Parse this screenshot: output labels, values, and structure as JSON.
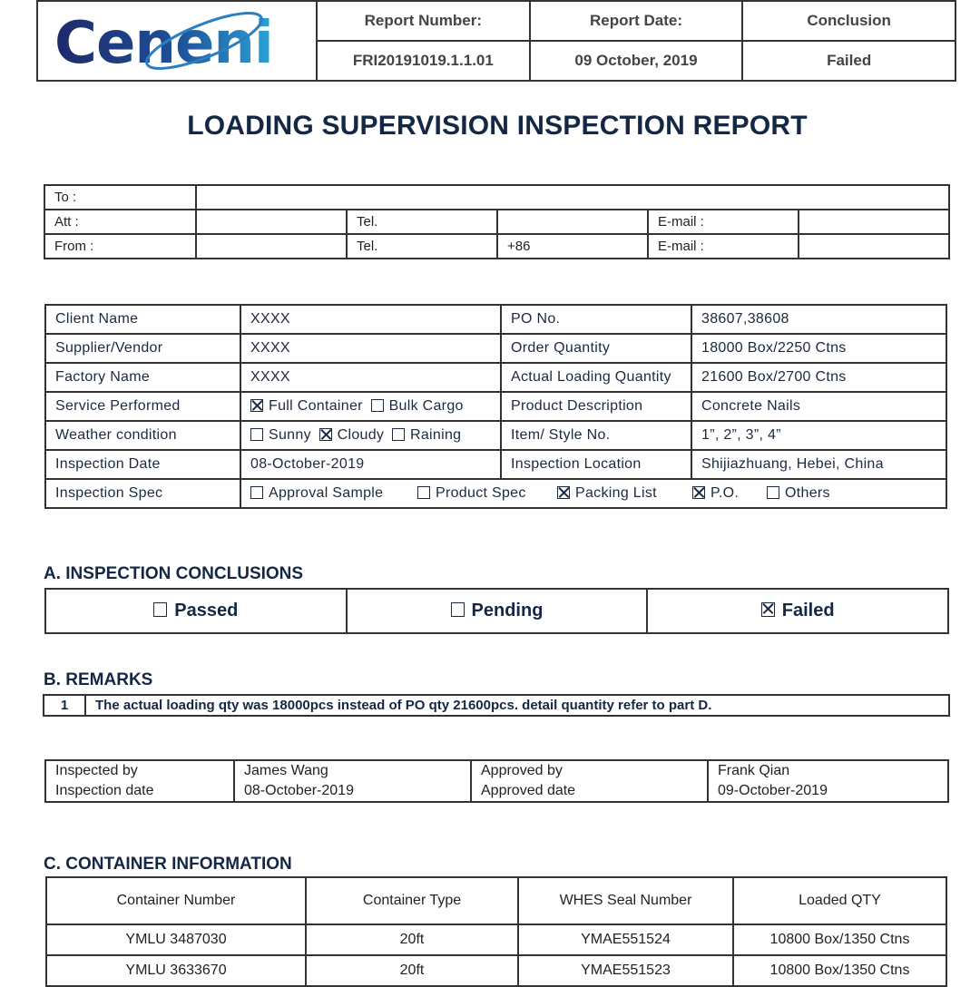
{
  "brand": {
    "logo_text": "Ceneni",
    "colors": {
      "logo_dark": "#1e2f6e",
      "logo_light": "#2aa0d8",
      "text_navy": "#142744"
    }
  },
  "header": {
    "report_number_label": "Report Number:",
    "report_date_label": "Report Date:",
    "conclusion_label": "Conclusion",
    "report_number": "FRI20191019.1.1.01",
    "report_date": "09 October, 2019",
    "conclusion": "Failed"
  },
  "title": "LOADING SUPERVISION INSPECTION REPORT",
  "contact": {
    "to_label": "To :",
    "to": "",
    "att_label": "Att :",
    "att": "",
    "att_tel_label": "Tel.",
    "att_tel": "",
    "att_email_label": "E-mail :",
    "att_email": "",
    "from_label": "From :",
    "from": "",
    "from_tel_label": "Tel.",
    "from_tel": "+86",
    "from_email_label": "E-mail :",
    "from_email": ""
  },
  "info": {
    "client_name_label": "Client Name",
    "client_name": "XXXX",
    "po_no_label": "PO No.",
    "po_no": "38607,38608",
    "supplier_label": "Supplier/Vendor",
    "supplier": "XXXX",
    "order_qty_label": "Order Quantity",
    "order_qty": "18000 Box/2250 Ctns",
    "factory_label": "Factory Name",
    "factory": "XXXX",
    "actual_qty_label": "Actual Loading Quantity",
    "actual_qty": "21600 Box/2700 Ctns",
    "service_label": "Service Performed",
    "service_options": [
      {
        "label": "Full Container",
        "checked": true
      },
      {
        "label": "Bulk Cargo",
        "checked": false
      }
    ],
    "product_desc_label": "Product Description",
    "product_desc": "Concrete Nails",
    "weather_label": "Weather condition",
    "weather_options": [
      {
        "label": "Sunny",
        "checked": false
      },
      {
        "label": "Cloudy",
        "checked": true
      },
      {
        "label": "Raining",
        "checked": false
      }
    ],
    "item_label": "Item/ Style No.",
    "item": "1”, 2”, 3”, 4”",
    "inspection_date_label": "Inspection Date",
    "inspection_date": "08-October-2019",
    "location_label": "Inspection Location",
    "location": "Shijiazhuang, Hebei, China",
    "spec_label": "Inspection Spec",
    "spec_options": [
      {
        "label": "Approval Sample",
        "checked": false
      },
      {
        "label": "Product Spec",
        "checked": false
      },
      {
        "label": "Packing List",
        "checked": true
      },
      {
        "label": "P.O.",
        "checked": true
      },
      {
        "label": "Others",
        "checked": false
      }
    ]
  },
  "conclusions": {
    "heading": "A. INSPECTION CONCLUSIONS",
    "options": [
      {
        "label": "Passed",
        "checked": false
      },
      {
        "label": "Pending",
        "checked": false
      },
      {
        "label": "Failed",
        "checked": true
      }
    ]
  },
  "remarks": {
    "heading": "B. REMARKS",
    "items": [
      {
        "num": "1",
        "text": "The actual  loading  qty was 18000pcs instead of PO qty 21600pcs. detail quantity refer to part D."
      }
    ]
  },
  "signoff": {
    "inspected_by_label": "Inspected by",
    "inspected_by": "James Wang",
    "inspection_date_label": "Inspection date",
    "inspection_date": "08-October-2019",
    "approved_by_label": "Approved by",
    "approved_by": "Frank Qian",
    "approved_date_label": "Approved date",
    "approved_date": "09-October-2019"
  },
  "containers": {
    "heading": "C. CONTAINER INFORMATION",
    "columns": [
      "Container Number",
      "Container Type",
      "WHES Seal Number",
      "Loaded QTY"
    ],
    "rows": [
      [
        "YMLU 3487030",
        "20ft",
        "YMAE551524",
        "10800 Box/1350 Ctns"
      ],
      [
        "YMLU 3633670",
        "20ft",
        "YMAE551523",
        "10800 Box/1350 Ctns"
      ]
    ]
  }
}
